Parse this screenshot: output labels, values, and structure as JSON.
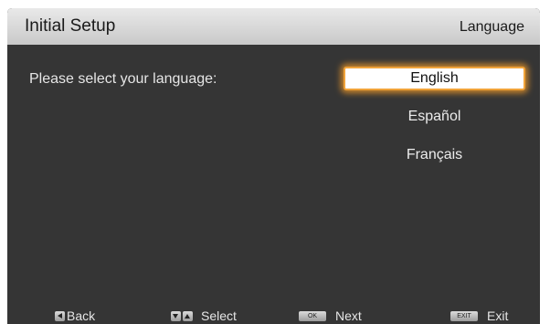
{
  "header": {
    "title": "Initial Setup",
    "section": "Language"
  },
  "prompt": "Please select your language:",
  "languages": {
    "selected": "English",
    "items": [
      "English",
      "Español",
      "Français"
    ]
  },
  "footer": {
    "back": {
      "icon": "left-arrow-key-icon",
      "label": "Back"
    },
    "select": {
      "icons": [
        "down-arrow-key-icon",
        "up-arrow-key-icon"
      ],
      "label": "Select"
    },
    "next": {
      "key_label": "OK",
      "label": "Next"
    },
    "exit": {
      "key_label": "EXIT",
      "label": "Exit"
    }
  },
  "colors": {
    "background": "#353535",
    "header": "#d9d9d9",
    "highlight_glow": "#f0a33a",
    "text": "#e6e6e6"
  }
}
